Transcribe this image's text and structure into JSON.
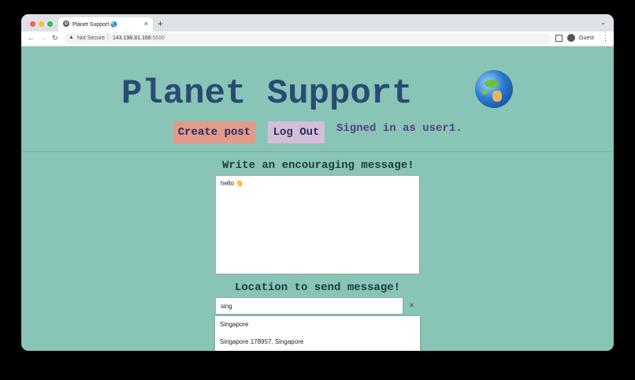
{
  "browser": {
    "tab_title": "Planet Support 🌏",
    "tab_close": "×",
    "new_tab": "+",
    "security_text": "Not Secure",
    "url_host": "143.198.81.168",
    "url_port": ":5000",
    "profile_label": "Guest"
  },
  "site": {
    "title": "Planet Support",
    "signed_in": "Signed in as user1."
  },
  "nav": {
    "create_post": "Create post",
    "log_out": "Log Out"
  },
  "form": {
    "message_label": "Write an encouraging message!",
    "message_value": "hello 👋",
    "location_label": "Location to send message!",
    "location_value": "sing",
    "clear_icon": "×",
    "suggestions": [
      "Singapore",
      "Singapore 178957, Singapore"
    ]
  },
  "colors": {
    "page_bg": "#88c5b6",
    "title": "#2a4a74",
    "create_btn": "#e29a8a",
    "logout_btn": "#d5bdd9",
    "signed_in": "#5a3c86"
  }
}
